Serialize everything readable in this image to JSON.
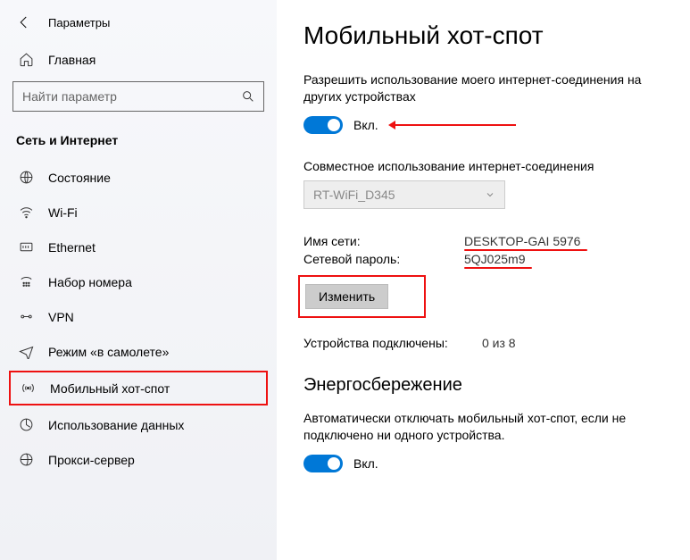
{
  "header": {
    "app_title": "Параметры"
  },
  "sidebar": {
    "home_label": "Главная",
    "search_placeholder": "Найти параметр",
    "group_title": "Сеть и Интернет",
    "items": [
      {
        "label": "Состояние"
      },
      {
        "label": "Wi-Fi"
      },
      {
        "label": "Ethernet"
      },
      {
        "label": "Набор номера"
      },
      {
        "label": "VPN"
      },
      {
        "label": "Режим «в самолете»"
      },
      {
        "label": "Мобильный хот-спот"
      },
      {
        "label": "Использование данных"
      },
      {
        "label": "Прокси-сервер"
      }
    ]
  },
  "main": {
    "title": "Мобильный хот-спот",
    "share_description": "Разрешить использование моего интернет-соединения на других устройствах",
    "toggle_on_label": "Вкл.",
    "share_conn_label": "Совместное использование интернет-соединения",
    "share_conn_value": "RT-WiFi_D345",
    "net_name_label": "Имя сети:",
    "net_name_value": "DESKTOP-GAI 5976",
    "net_pass_label": "Сетевой пароль:",
    "net_pass_value": "5QJ025m9",
    "edit_button": "Изменить",
    "devices_label": "Устройства подключены:",
    "devices_value": "0 из 8",
    "power_title": "Энергосбережение",
    "power_desc": "Автоматически отключать мобильный хот-спот, если не подключено ни одного устройства.",
    "power_toggle_label": "Вкл."
  }
}
